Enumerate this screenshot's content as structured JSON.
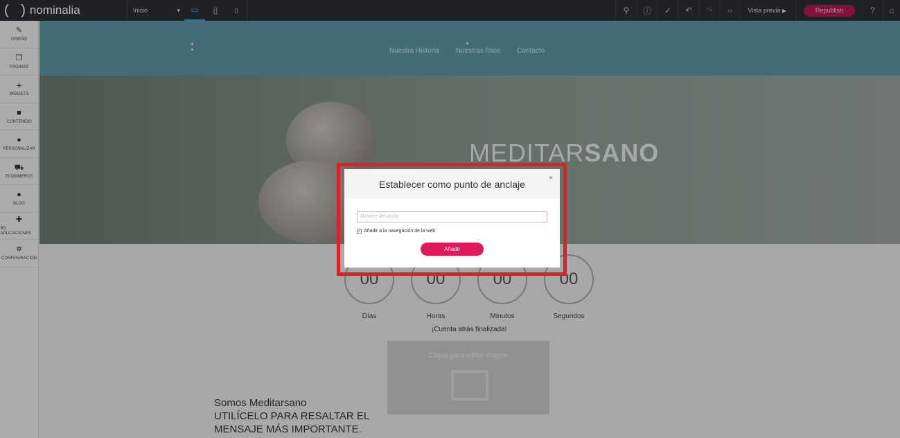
{
  "topbar": {
    "logo_text": "nominalia",
    "logo_paren": "( )",
    "page_select": "Inicio",
    "page_select_icon": "▾",
    "devices": [
      {
        "name": "desktop-icon",
        "glyph": "▭"
      },
      {
        "name": "tablet-icon",
        "glyph": "▯"
      },
      {
        "name": "mobile-icon",
        "glyph": "▯"
      }
    ],
    "tools": [
      {
        "name": "search-icon",
        "glyph": "⚲"
      },
      {
        "name": "info-icon",
        "glyph": "ⓘ"
      },
      {
        "name": "check-icon",
        "glyph": "✓"
      },
      {
        "name": "undo-icon",
        "glyph": "↶"
      },
      {
        "name": "redo-icon",
        "glyph": "↷"
      },
      {
        "name": "code-icon",
        "glyph": "‹›"
      }
    ],
    "preview_label": "Vista previa",
    "preview_icon": "▶",
    "republish_label": "Republish",
    "help_icon": "?",
    "home_icon": "⌂",
    "republish_color": "#b4194f"
  },
  "sidebar": {
    "items": [
      {
        "name": "sidebar-item-diseno",
        "icon": "✎",
        "icon_name": "brush-icon",
        "label": "DISEÑO"
      },
      {
        "name": "sidebar-item-paginas",
        "icon": "❐",
        "icon_name": "pages-icon",
        "label": "PÁGINAS"
      },
      {
        "name": "sidebar-item-widgets",
        "icon": "+",
        "icon_name": "plus-icon",
        "label": "WIDGETS"
      },
      {
        "name": "sidebar-item-contenido",
        "icon": "■",
        "icon_name": "folder-icon",
        "label": "CONTENIDO"
      },
      {
        "name": "sidebar-item-personalizar",
        "icon": "●",
        "icon_name": "user-icon",
        "label": "PERSONALIZAR"
      },
      {
        "name": "sidebar-item-ecommerce",
        "icon": "⛟",
        "icon_name": "cart-icon",
        "label": "ECOMMERCE"
      },
      {
        "name": "sidebar-item-blog",
        "icon": "●",
        "icon_name": "chat-icon",
        "label": "BLOG"
      },
      {
        "name": "sidebar-item-aplicaciones",
        "icon": "✚",
        "icon_name": "apps-icon",
        "label": "RS APLICACIONES"
      },
      {
        "name": "sidebar-item-configuracion",
        "icon": "✲",
        "icon_name": "gear-icon",
        "label": "CONFIGURACIÓN"
      }
    ]
  },
  "site": {
    "nav": [
      "Nuestra Historia",
      "Nuestras fotos",
      "Contacto"
    ],
    "hero_title_light": "MEDITAR",
    "hero_title_bold": "SANO",
    "countdown": [
      {
        "value": "00",
        "label": "Días"
      },
      {
        "value": "00",
        "label": "Horas"
      },
      {
        "value": "00",
        "label": "Minutos"
      },
      {
        "value": "00",
        "label": "Segundos"
      }
    ],
    "countdown_finished": "¡Cuenta atrás finalizada!",
    "image_placeholder": "Clique para editar imagen",
    "body_lines": [
      "Somos Meditarsano",
      "UTILÍCELO PARA RESALTAR EL",
      "MENSAJE MÁS IMPORTANTE."
    ]
  },
  "modal": {
    "title": "Establecer como punto de anclaje",
    "close_icon": "×",
    "input_placeholder": "Nombre del ancla",
    "checkbox_label": "Añadir a la navegación de la web",
    "checkbox_checked": true,
    "button_label": "Añadir",
    "highlight_color": "#e02020",
    "button_color": "#e1185a"
  }
}
